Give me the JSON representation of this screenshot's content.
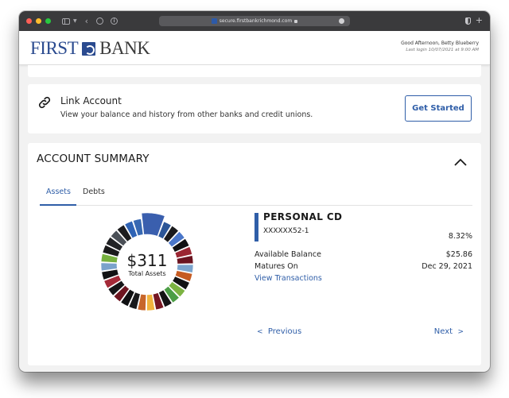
{
  "browser": {
    "url": "secure.firstbankrichmond.com",
    "traffic_lights": [
      "#ff5f57",
      "#febc2e",
      "#28c840"
    ]
  },
  "header": {
    "logo_first": "FIRST",
    "logo_bank": "BANK",
    "greeting": "Good Afternoon, Betty Blueberry",
    "last_login": "Last login 10/07/2021 at 9:00 AM"
  },
  "link_account": {
    "title": "Link Account",
    "description": "View your balance and history from other banks and credit unions.",
    "button_label": "Get Started"
  },
  "account_summary": {
    "title": "ACCOUNT SUMMARY",
    "tabs": [
      {
        "label": "Assets",
        "active": true
      },
      {
        "label": "Debts",
        "active": false
      }
    ],
    "donut": {
      "total": "$311",
      "label": "Total Assets",
      "selected_index": 0,
      "segments": [
        {
          "color": "#3a5fae"
        },
        {
          "color": "#2b5597"
        },
        {
          "color": "#1a1a1c"
        },
        {
          "color": "#4a76c9"
        },
        {
          "color": "#111113"
        },
        {
          "color": "#9b2632"
        },
        {
          "color": "#6b1420"
        },
        {
          "color": "#7ba4cd"
        },
        {
          "color": "#c65b22"
        },
        {
          "color": "#121214"
        },
        {
          "color": "#7cb342"
        },
        {
          "color": "#4c9e46"
        },
        {
          "color": "#141416"
        },
        {
          "color": "#761722"
        },
        {
          "color": "#f1b43e"
        },
        {
          "color": "#c8662a"
        },
        {
          "color": "#19191b"
        },
        {
          "color": "#101012"
        },
        {
          "color": "#6e1520"
        },
        {
          "color": "#161618"
        },
        {
          "color": "#a42a38"
        },
        {
          "color": "#121214"
        },
        {
          "color": "#7aa2cb"
        },
        {
          "color": "#77b13f"
        },
        {
          "color": "#1a1a1c"
        },
        {
          "color": "#222326"
        },
        {
          "color": "#4b5057"
        },
        {
          "color": "#1c1c1e"
        },
        {
          "color": "#2f63b5"
        },
        {
          "color": "#3768b2"
        }
      ]
    },
    "account": {
      "name": "PERSONAL CD",
      "number": "XXXXXX52-1",
      "percent": "8.32%",
      "balance_label": "Available Balance",
      "balance_value": "$25.86",
      "matures_label": "Matures On",
      "matures_value": "Dec 29, 2021",
      "view_transactions": "View Transactions"
    },
    "nav": {
      "previous": "Previous",
      "next": "Next"
    }
  }
}
